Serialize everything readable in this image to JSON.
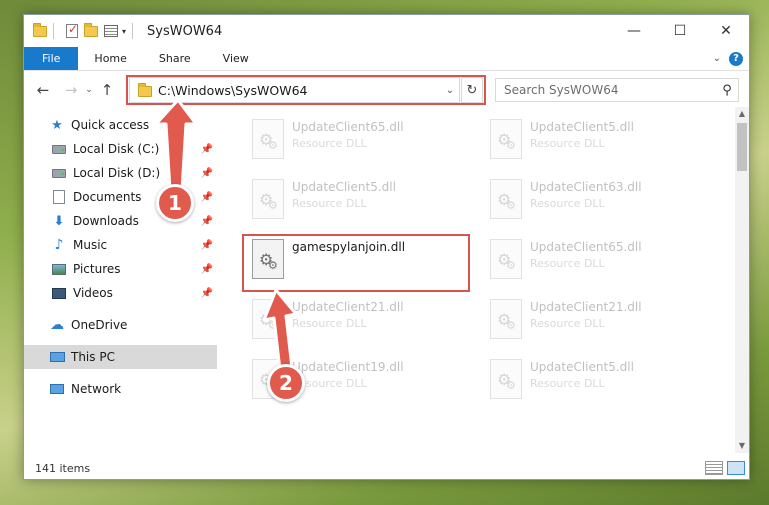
{
  "window": {
    "title": "SysWOW64",
    "minimize_glyph": "—",
    "maximize_glyph": "☐",
    "close_glyph": "✕"
  },
  "ribbon": {
    "tabs": [
      "File",
      "Home",
      "Share",
      "View"
    ],
    "expand_glyph": "⌄",
    "help_glyph": "?"
  },
  "nav": {
    "back_glyph": "←",
    "forward_glyph": "→",
    "recent_glyph": "⌄",
    "up_glyph": "↑",
    "address": "C:\\Windows\\SysWOW64",
    "address_drop_glyph": "⌄",
    "refresh_glyph": "↻",
    "search_placeholder": "Search SysWOW64",
    "search_glyph": "⚲"
  },
  "sidebar": {
    "pin_glyph": "📌",
    "items": [
      {
        "label": "Quick access"
      },
      {
        "label": "Local Disk (C:)"
      },
      {
        "label": "Local Disk (D:)"
      },
      {
        "label": "Documents"
      },
      {
        "label": "Downloads"
      },
      {
        "label": "Music"
      },
      {
        "label": "Pictures"
      },
      {
        "label": "Videos"
      },
      {
        "label": "OneDrive"
      },
      {
        "label": "This PC"
      },
      {
        "label": "Network"
      }
    ]
  },
  "files": {
    "highlighted": {
      "name": "gamespylanjoin.dll"
    },
    "left_column": [
      {
        "name": "UpdateClient65.dll",
        "type": "Resource DLL"
      },
      {
        "name": "UpdateClient5.dll",
        "type": "Resource DLL"
      },
      {
        "name": "UpdateClient21.dll",
        "type": "Resource DLL"
      },
      {
        "name": "UpdateClient19.dll",
        "type": "Resource DLL"
      }
    ],
    "right_column": [
      {
        "name": "UpdateClient5.dll",
        "type": "Resource DLL"
      },
      {
        "name": "UpdateClient63.dll",
        "type": "Resource DLL"
      },
      {
        "name": "UpdateClient65.dll",
        "type": "Resource DLL"
      },
      {
        "name": "UpdateClient21.dll",
        "type": "Resource DLL"
      },
      {
        "name": "UpdateClient5.dll",
        "type": "Resource DLL"
      }
    ]
  },
  "status": {
    "item_count": "141 items"
  },
  "annotations": {
    "step1": "1",
    "step2": "2",
    "color": "#e05a4e"
  },
  "scrollbar": {
    "up_glyph": "▲",
    "down_glyph": "▼"
  },
  "icons": {
    "gear_glyph": "⚙",
    "star_glyph": "★",
    "download_glyph": "⬇",
    "music_glyph": "♪",
    "cloud_glyph": "☁"
  }
}
